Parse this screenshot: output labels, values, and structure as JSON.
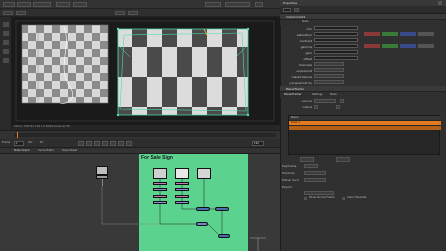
{
  "viewer": {
    "status_left": "1024 x 768  HD  2.04  1.0  RGB  (Scanline)  f/8",
    "frame_current": "1",
    "frame_end": "120",
    "fps": "24*",
    "timecode_label": "TC",
    "frame_label": "Frame"
  },
  "node_graph": {
    "tabs": [
      "Node Graph",
      "Curve Editor",
      "Dope Sheet"
    ],
    "backdrop_title": "For Sale Sign",
    "backdrop_color": "#5bd38e",
    "selection_color": "#e27b1f"
  },
  "properties": {
    "panel_title": "Properties",
    "node1_name": "ColorCorrect1",
    "node1_tab": "Node",
    "rows": [
      "mix",
      "saturation",
      "contrast",
      "gamma",
      "gain",
      "offset",
      "channels",
      "unpremult",
      "maskChannel",
      "(un)premult by"
    ],
    "node2_name": "PlanarTrack1",
    "node2_tabs": [
      "PlanarTracker",
      "Settings",
      "Node"
    ],
    "tracker_rows": [
      "source",
      "output"
    ],
    "layer_header": "Name",
    "layer_selected": "Track 1",
    "bottom_rows": [
      "Keyframe",
      "Trackme",
      "Planar Surf.",
      "Export"
    ],
    "checks": [
      "Show Source Frame",
      "Clear Translate"
    ],
    "accent_color": "#e27b1f"
  }
}
